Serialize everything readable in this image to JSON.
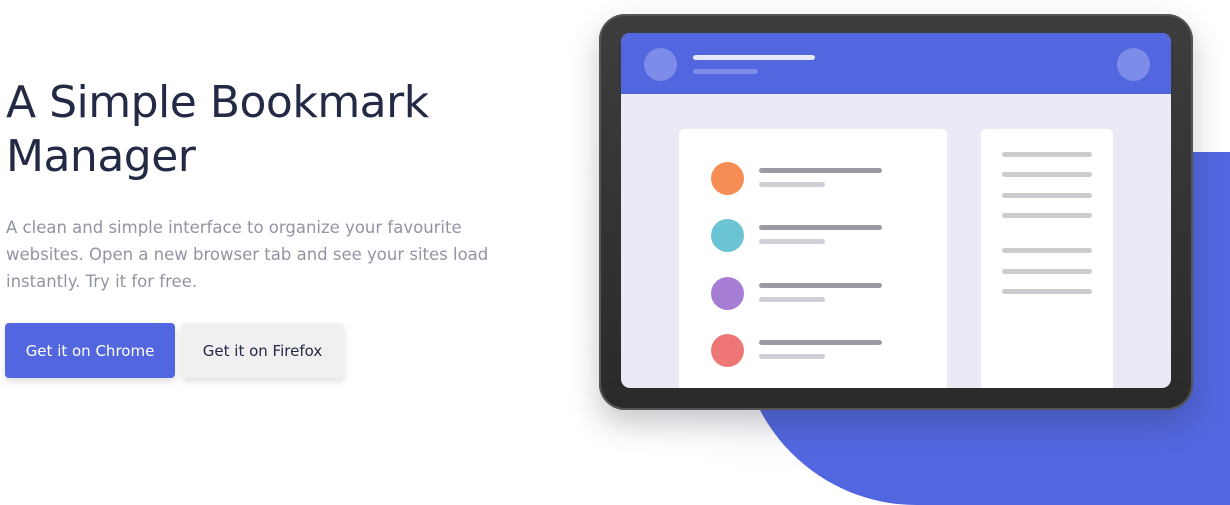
{
  "hero": {
    "title": "A Simple Bookmark Manager",
    "description": "A clean and simple interface to organize your favourite websites. Open a new browser tab and see your sites load instantly. Try it for free."
  },
  "actions": {
    "chrome_label": "Get it on Chrome",
    "firefox_label": "Get it on Firefox"
  },
  "colors": {
    "primary": "#5267df",
    "heading": "#242a45",
    "body_text": "#9194a2",
    "secondary_button": "#f0f0f0"
  },
  "illustration": {
    "bookmark_dots": [
      {
        "color": "#f68d55"
      },
      {
        "color": "#6bc4d4"
      },
      {
        "color": "#a57dd4"
      },
      {
        "color": "#ee7775"
      }
    ]
  }
}
